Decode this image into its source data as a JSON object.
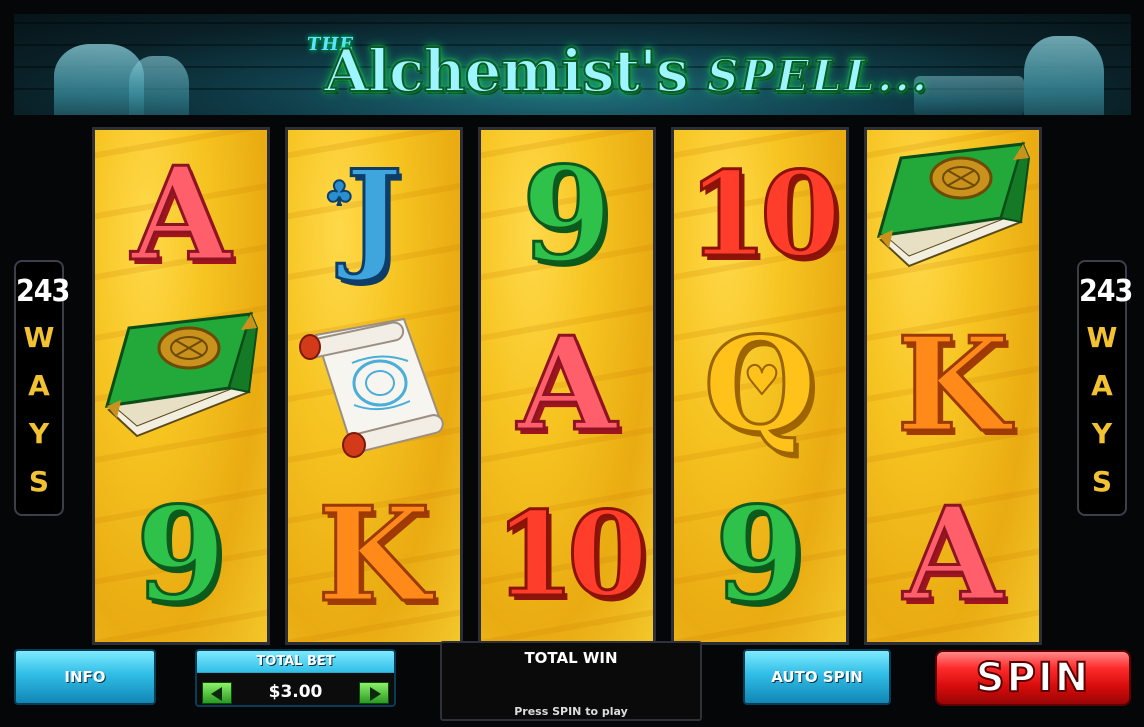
{
  "game": {
    "title_prefix": "THE",
    "title_main": "Alchemist's",
    "title_suffix": "SPELL..."
  },
  "ways": {
    "left": {
      "number": "243",
      "letters": [
        "W",
        "A",
        "Y",
        "S"
      ]
    },
    "right": {
      "number": "243",
      "letters": [
        "W",
        "A",
        "Y",
        "S"
      ]
    }
  },
  "reels": [
    [
      {
        "symbol": "A"
      },
      {
        "symbol": "book-icon"
      },
      {
        "symbol": "9"
      }
    ],
    [
      {
        "symbol": "J"
      },
      {
        "symbol": "scroll-icon"
      },
      {
        "symbol": "K"
      }
    ],
    [
      {
        "symbol": "9"
      },
      {
        "symbol": "A"
      },
      {
        "symbol": "10"
      }
    ],
    [
      {
        "symbol": "10"
      },
      {
        "symbol": "Q"
      },
      {
        "symbol": "9"
      }
    ],
    [
      {
        "symbol": "book-icon"
      },
      {
        "symbol": "K"
      },
      {
        "symbol": "A"
      }
    ]
  ],
  "controls": {
    "info_label": "INFO",
    "total_bet_label": "TOTAL BET",
    "total_bet_value": "$3.00",
    "total_win_label": "TOTAL WIN",
    "total_win_message": "Press SPIN to play",
    "autospin_label": "AUTO SPIN",
    "spin_label": "SPIN"
  },
  "colors": {
    "reel_background": "#f6c421",
    "spin_button": "#e01010",
    "control_blue": "#2fbde6",
    "ways_text": "#f2c232"
  }
}
